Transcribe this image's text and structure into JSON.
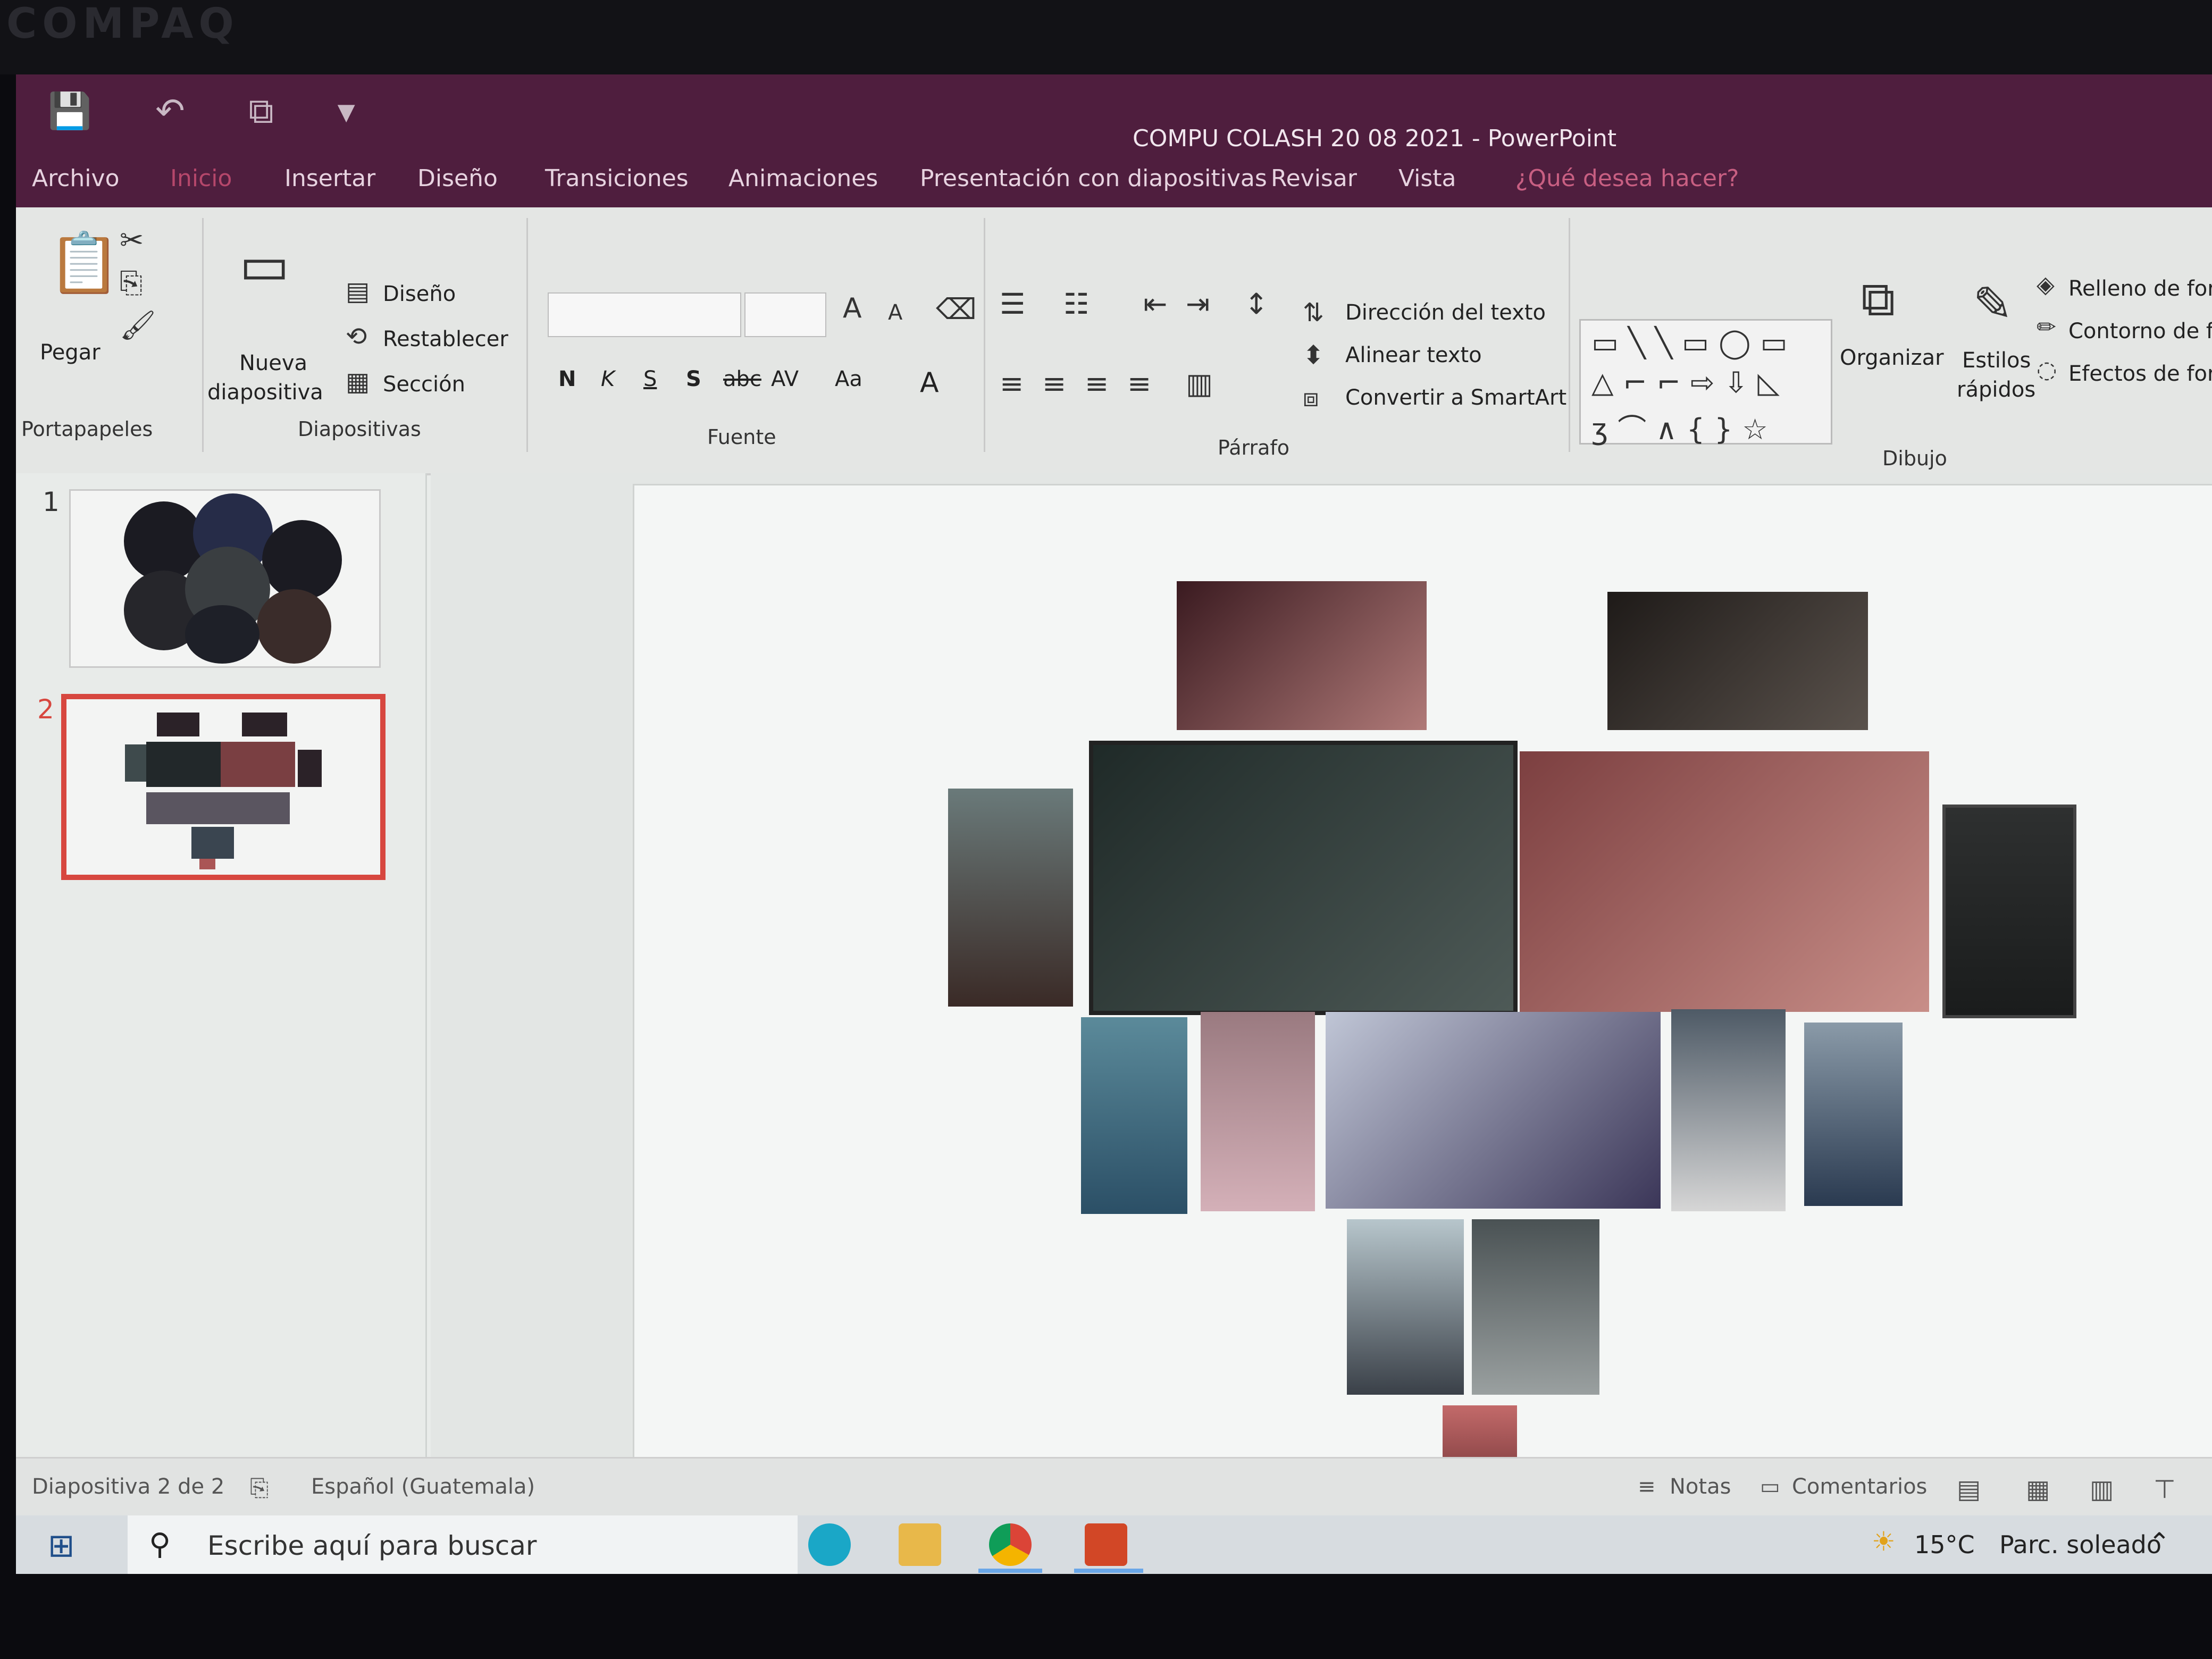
{
  "window": {
    "title": "COMPU COLASH  20 08 2021 - PowerPoint"
  },
  "brand": "COMPAQ",
  "tabs": [
    {
      "label": "Archivo"
    },
    {
      "label": "Inicio"
    },
    {
      "label": "Insertar"
    },
    {
      "label": "Diseño"
    },
    {
      "label": "Transiciones"
    },
    {
      "label": "Animaciones"
    },
    {
      "label": "Presentación con diapositivas"
    },
    {
      "label": "Revisar"
    },
    {
      "label": "Vista"
    },
    {
      "label": "¿Qué desea hacer?"
    }
  ],
  "ribbon": {
    "portapapeles": {
      "pegar": "Pegar",
      "label": "Portapapeles"
    },
    "diapositivas": {
      "nueva_line1": "Nueva",
      "nueva_line2": "diapositiva",
      "diseno": "Diseño",
      "restablecer": "Restablecer",
      "seccion": "Sección",
      "label": "Diapositivas"
    },
    "fuente": {
      "bold": "N",
      "italic": "K",
      "underline": "S",
      "shadow": "S",
      "strike": "abc",
      "spacing": "AV",
      "case": "Aa",
      "color": "A",
      "label": "Fuente"
    },
    "parrafo": {
      "direccion": "Dirección del texto",
      "alinear": "Alinear texto",
      "convertir": "Convertir a SmartArt",
      "label": "Párrafo"
    },
    "dibujo": {
      "organizar": "Organizar",
      "estilos_line1": "Estilos",
      "estilos_line2": "rápidos",
      "relleno": "Relleno de form",
      "contorno": "Contorno de fo",
      "efectos": "Efectos de form",
      "label": "Dibujo"
    }
  },
  "slides": [
    {
      "number": "1"
    },
    {
      "number": "2"
    }
  ],
  "status": {
    "slide_info": "Diapositiva 2 de 2",
    "language": "Español (Guatemala)",
    "notes": "Notas",
    "comments": "Comentarios"
  },
  "taskbar": {
    "search_placeholder": "Escribe aquí para buscar",
    "weather_temp": "15°C",
    "weather_desc": "Parc. soleado"
  },
  "colors": {
    "titlebar": "#4f1e3e",
    "accent_selected": "#d7473f"
  }
}
